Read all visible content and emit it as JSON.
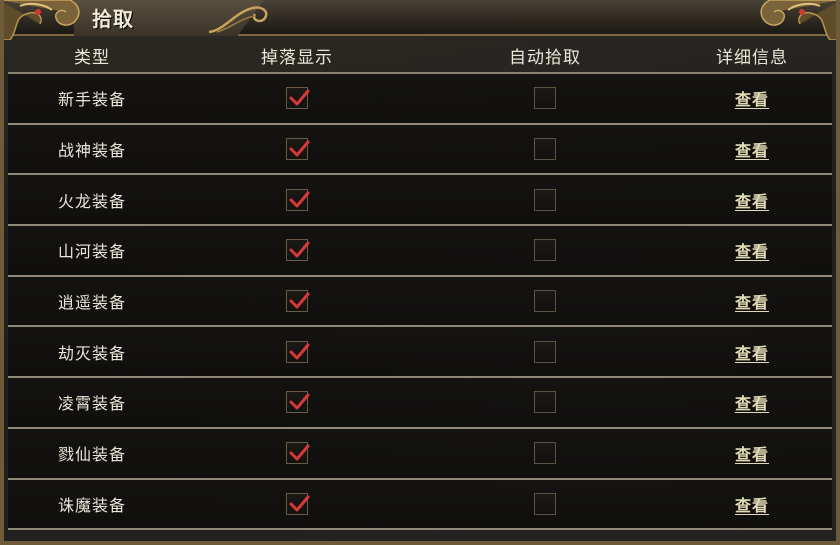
{
  "title": "拾取",
  "columns": {
    "type": "类型",
    "drop_display": "掉落显示",
    "auto_pickup": "自动拾取",
    "details": "详细信息"
  },
  "rows": [
    {
      "type": "新手装备",
      "drop_display": true,
      "auto_pickup": false,
      "details_link": "查看"
    },
    {
      "type": "战神装备",
      "drop_display": true,
      "auto_pickup": false,
      "details_link": "查看"
    },
    {
      "type": "火龙装备",
      "drop_display": true,
      "auto_pickup": false,
      "details_link": "查看"
    },
    {
      "type": "山河装备",
      "drop_display": true,
      "auto_pickup": false,
      "details_link": "查看"
    },
    {
      "type": "逍遥装备",
      "drop_display": true,
      "auto_pickup": false,
      "details_link": "查看"
    },
    {
      "type": "劫灭装备",
      "drop_display": true,
      "auto_pickup": false,
      "details_link": "查看"
    },
    {
      "type": "凌霄装备",
      "drop_display": true,
      "auto_pickup": false,
      "details_link": "查看"
    },
    {
      "type": "戮仙装备",
      "drop_display": true,
      "auto_pickup": false,
      "details_link": "查看"
    },
    {
      "type": "诛魔装备",
      "drop_display": true,
      "auto_pickup": false,
      "details_link": "查看"
    }
  ],
  "icons": {
    "corner_ornament": "dragon-icon",
    "checked": "checkmark-icon"
  },
  "colors": {
    "frame_gold": "#7d6843",
    "checkmark_red": "#d8383a",
    "link_text": "#e0dbb4"
  }
}
